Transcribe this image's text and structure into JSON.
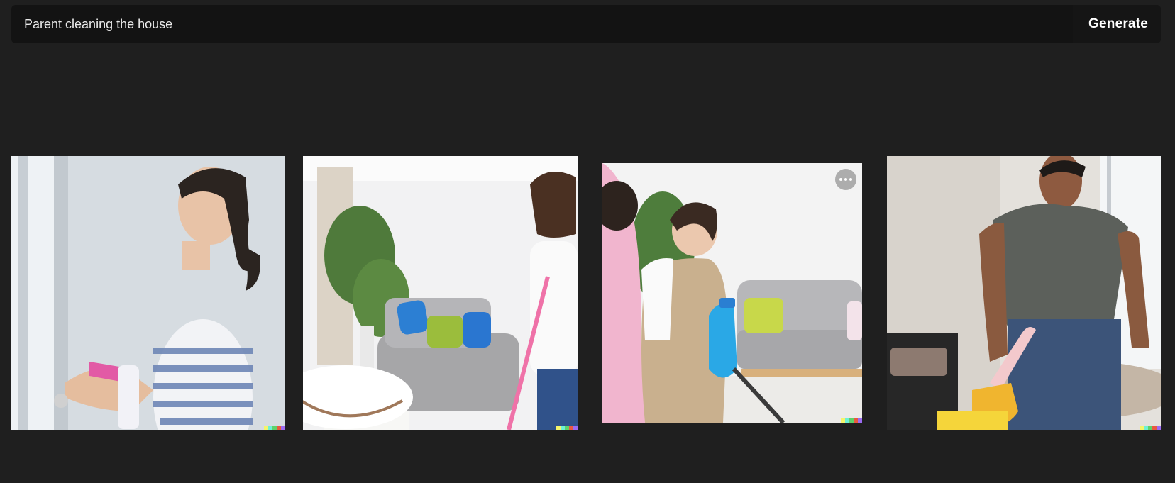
{
  "prompt": {
    "value": "Parent cleaning the house"
  },
  "toolbar": {
    "generate_label": "Generate"
  },
  "images": [
    {
      "name": "image-woman-cleaning-window"
    },
    {
      "name": "image-woman-mopping-living-room"
    },
    {
      "name": "image-woman-spraying-sofa"
    },
    {
      "name": "image-man-cleaning-table"
    }
  ],
  "colors": {
    "page_background": "#1f1f1f",
    "prompt_bar": "#131313",
    "signature": [
      "#f5f56b",
      "#6ef0d5",
      "#5fd16a",
      "#e9593f",
      "#9b6bf2"
    ]
  },
  "icons": {
    "more": "more-horizontal-icon"
  }
}
